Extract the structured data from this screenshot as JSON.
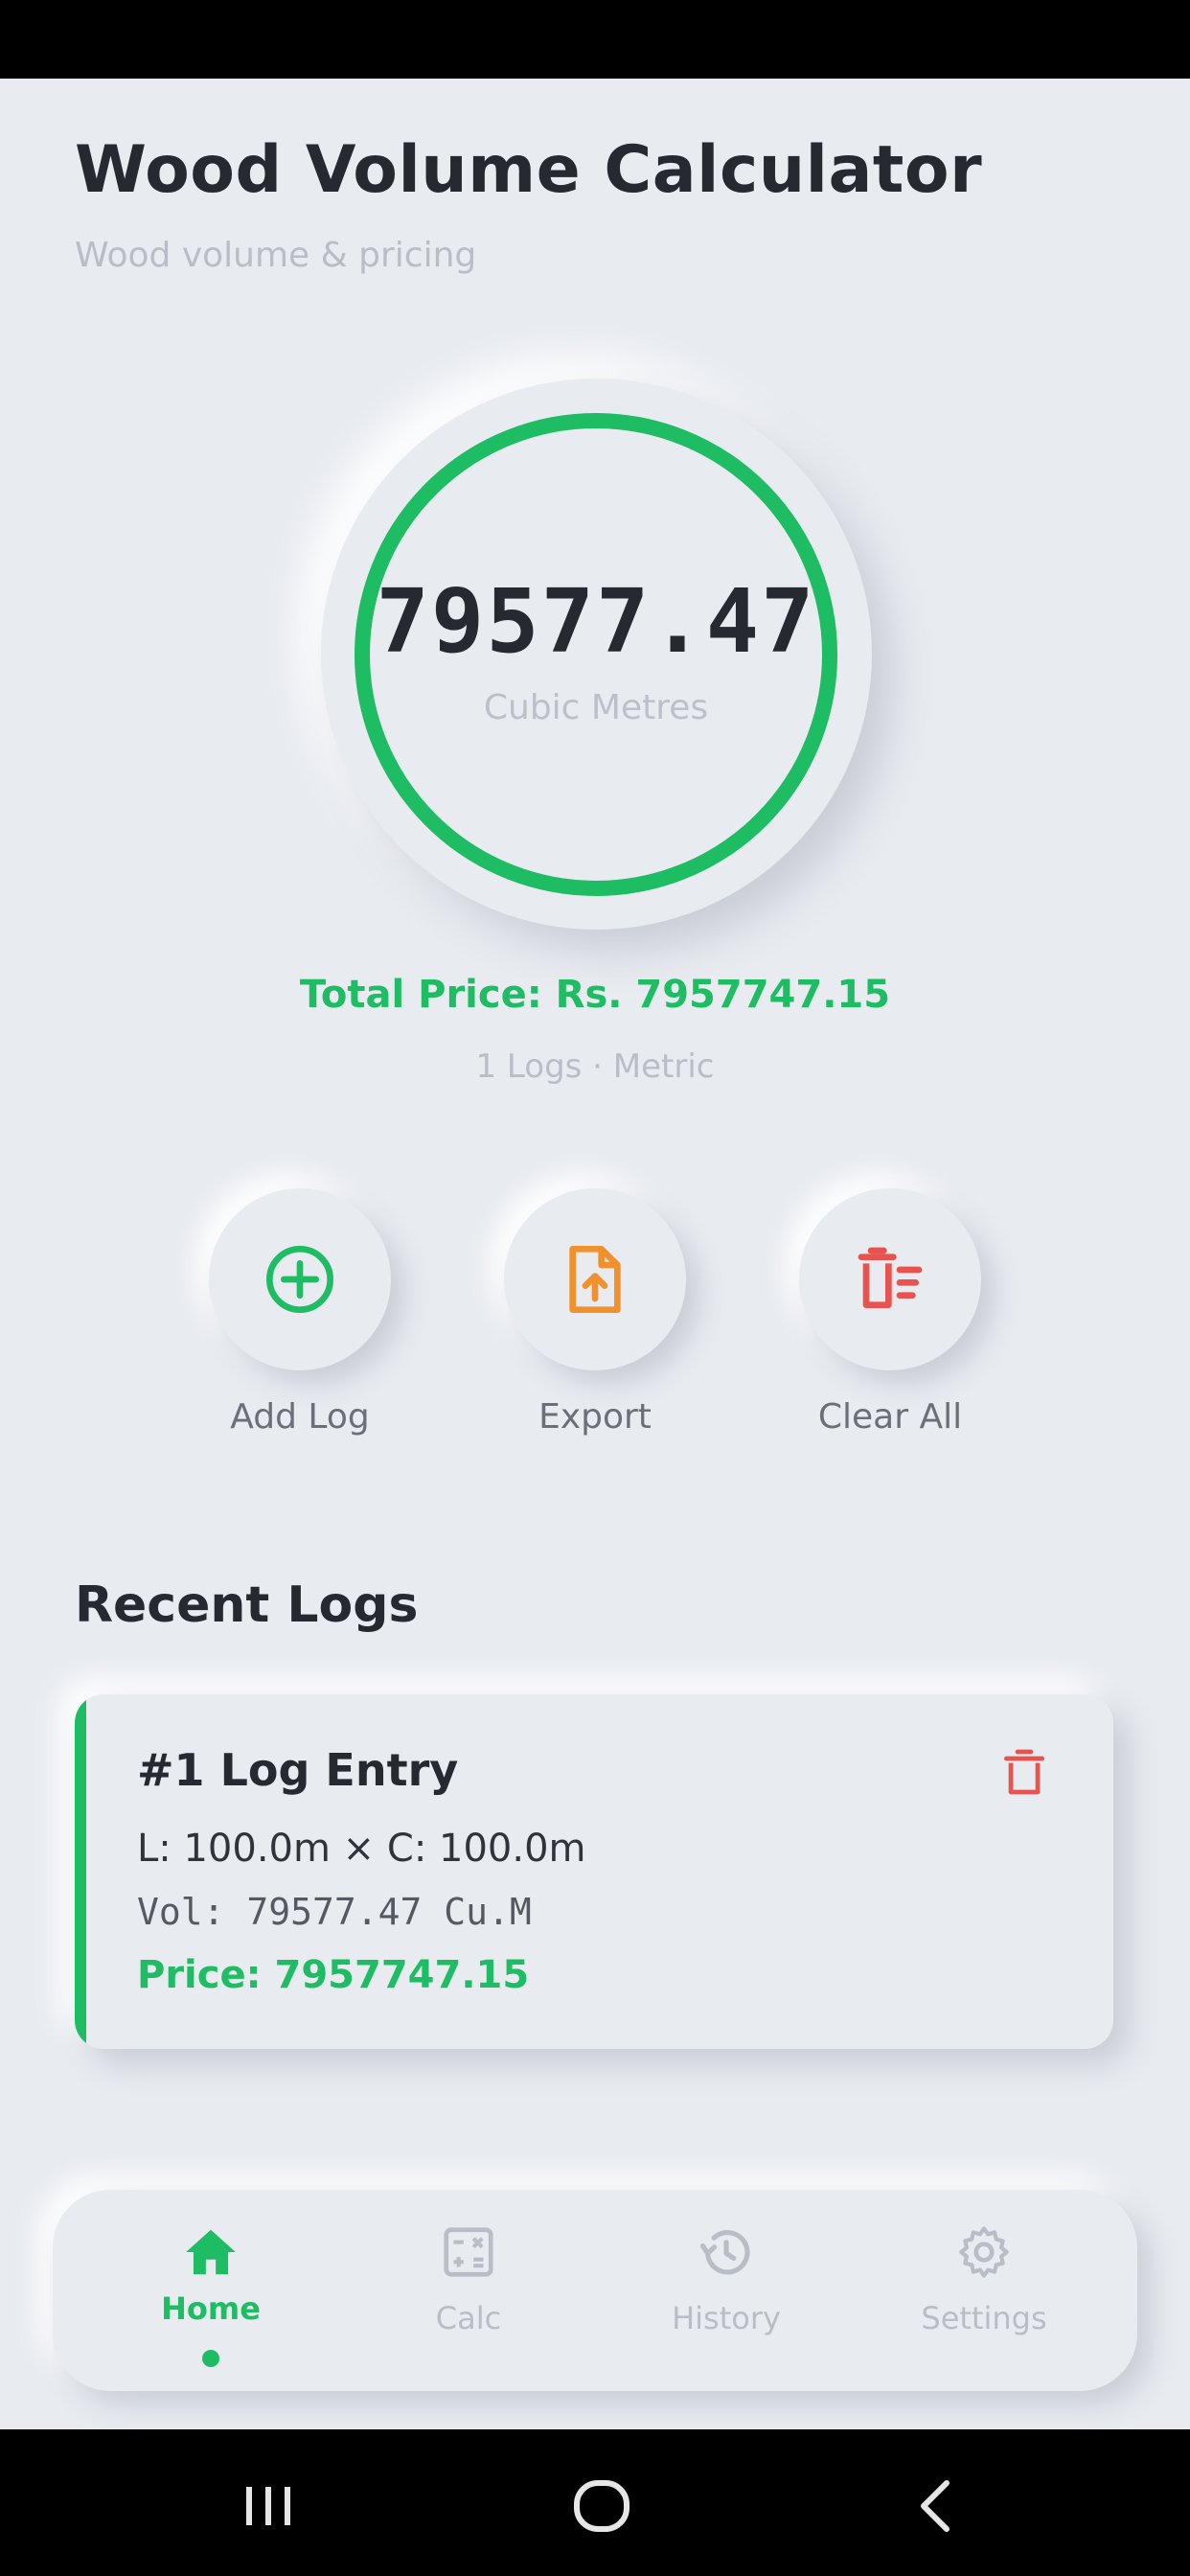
{
  "header": {
    "title": "Wood Volume Calculator",
    "subtitle": "Wood volume & pricing"
  },
  "gauge": {
    "value": "79577.47",
    "unit": "Cubic Metres"
  },
  "summary": {
    "total_price": "Total Price: Rs. 7957747.15",
    "meta": "1 Logs · Metric"
  },
  "actions": [
    {
      "label": "Add Log",
      "icon": "add-circle-icon"
    },
    {
      "label": "Export",
      "icon": "file-upload-icon"
    },
    {
      "label": "Clear All",
      "icon": "clear-list-icon"
    }
  ],
  "recent": {
    "title": "Recent Logs",
    "logs": [
      {
        "title": "#1  Log Entry",
        "dims": "L: 100.0m  ×  C: 100.0m",
        "volume": "Vol: 79577.47 Cu.M",
        "price": "Price: 7957747.15"
      }
    ]
  },
  "nav": [
    {
      "label": "Home",
      "icon": "home-icon",
      "active": true
    },
    {
      "label": "Calc",
      "icon": "calculator-icon",
      "active": false
    },
    {
      "label": "History",
      "icon": "history-icon",
      "active": false
    },
    {
      "label": "Settings",
      "icon": "gear-icon",
      "active": false
    }
  ],
  "colors": {
    "accent": "#1ebc63",
    "export": "#f0912e",
    "danger": "#e8534f",
    "background": "#e8ebf0"
  }
}
